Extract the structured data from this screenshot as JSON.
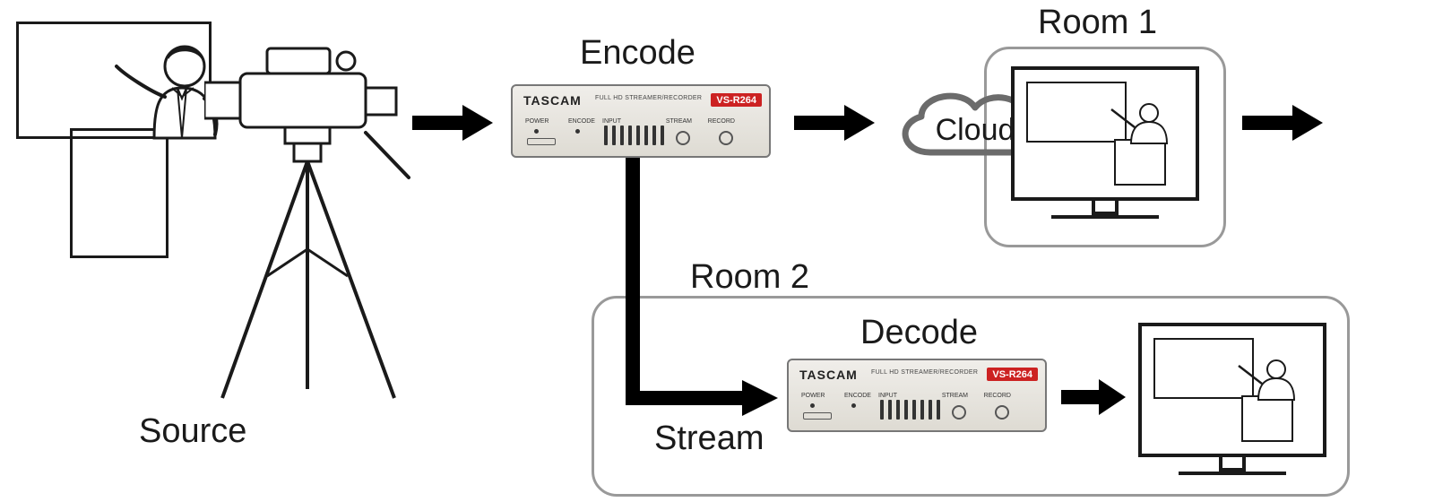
{
  "labels": {
    "source": "Source",
    "encode": "Encode",
    "decode": "Decode",
    "stream": "Stream",
    "cloud": "Cloud",
    "room1": "Room 1",
    "room2": "Room 2"
  },
  "device": {
    "brand": "TASCAM",
    "sub": "FULL HD STREAMER/RECORDER",
    "model": "VS-R264",
    "port_power": "POWER",
    "port_encode": "ENCODE",
    "port_input": "INPUT",
    "port_stream": "STREAM",
    "port_record": "RECORD"
  },
  "nodes": {
    "source": {
      "role": "video-source",
      "desc": "Presenter at podium filmed by camera on tripod"
    },
    "encoder": {
      "role": "encoder-device",
      "model_key": "device.model"
    },
    "cloud": {
      "role": "cloud-service"
    },
    "room1": {
      "role": "display-monitor",
      "content": "live presenter feed"
    },
    "decoder": {
      "role": "decoder-device",
      "model_key": "device.model"
    },
    "room2": {
      "role": "display-monitor",
      "content": "live presenter feed"
    }
  },
  "edges": [
    {
      "from": "source",
      "to": "encoder",
      "label": null
    },
    {
      "from": "encoder",
      "to": "cloud",
      "label": null
    },
    {
      "from": "cloud",
      "to": "room1",
      "label": null
    },
    {
      "from": "encoder",
      "to": "decoder",
      "label": "stream"
    },
    {
      "from": "decoder",
      "to": "room2",
      "label": null
    }
  ]
}
